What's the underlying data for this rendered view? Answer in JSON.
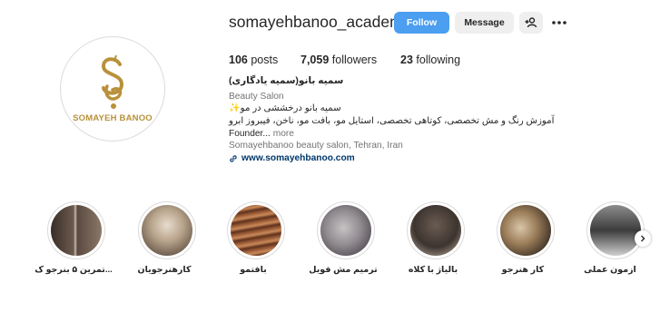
{
  "profile": {
    "username": "somayehbanoo_academy",
    "follow_label": "Follow",
    "message_label": "Message",
    "suggest_icon": "add-person-icon",
    "more_icon": "more-options-icon",
    "avatar_brand": "SOMAYEH BANOO",
    "stats": {
      "posts_count": "106",
      "posts_label": "posts",
      "followers_count": "7,059",
      "followers_label": "followers",
      "following_count": "23",
      "following_label": "following"
    },
    "bio": {
      "name": "سمیه بانو(سمیه یادگاری)",
      "category": "Beauty Salon",
      "line1": "سمیه بانو درخششی در مو✨",
      "line2": "آموزش رنگ و مش تخصصی، کوتاهی تخصصی، استایل مو، بافت مو، ناخن، فیبروز ابرو",
      "line3_text": "Founder...",
      "line3_more": "more",
      "address": "Somayehbanoo beauty salon, Tehran, Iran",
      "link": "www.somayehbanoo.com"
    },
    "colors": {
      "accent": "#4b9ef0",
      "brand_gold": "#b8913a",
      "link": "#00376b"
    }
  },
  "highlights": [
    {
      "label": "تمرین ۵ بنرجو ک..."
    },
    {
      "label": "کارهنرجویان"
    },
    {
      "label": "بافتمو"
    },
    {
      "label": "ترمیم مش فویل"
    },
    {
      "label": "بالیاژ با کلاه"
    },
    {
      "label": "کار هنرجو"
    },
    {
      "label": "آزمون عملی"
    }
  ]
}
